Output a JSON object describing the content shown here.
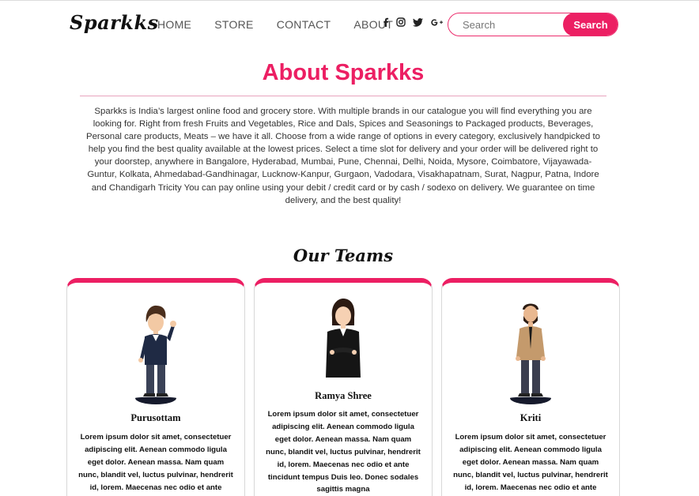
{
  "brand": {
    "logo": "Sparkks"
  },
  "nav": {
    "items": [
      "HOME",
      "STORE",
      "CONTACT",
      "ABOUT"
    ]
  },
  "social": {
    "icons": [
      "facebook-icon",
      "instagram-icon",
      "twitter-icon",
      "google-plus-icon"
    ]
  },
  "search": {
    "placeholder": "Search",
    "button_label": "Search"
  },
  "about": {
    "title": "About Sparkks",
    "text": "Sparkks is India’s largest online food and grocery store. With multiple brands in our catalogue you will find everything you are looking for. Right from fresh Fruits and Vegetables, Rice and Dals, Spices and Seasonings to Packaged products, Beverages, Personal care products, Meats – we have it all. Choose from a wide range of options in every category, exclusively handpicked to help you find the best quality available at the lowest prices. Select a time slot for delivery and your order will be delivered right to your doorstep, anywhere in Bangalore, Hyderabad, Mumbai, Pune, Chennai, Delhi, Noida, Mysore, Coimbatore, Vijayawada-Guntur, Kolkata, Ahmedabad-Gandhinagar, Lucknow-Kanpur, Gurgaon, Vadodara, Visakhapatnam, Surat, Nagpur, Patna, Indore and Chandigarh Tricity You can pay online using your debit / credit card or by cash / sodexo on delivery. We guarantee on time delivery, and the best quality!"
  },
  "teams": {
    "title": "Our Teams",
    "members": [
      {
        "name": "Purusottam",
        "bio": "Lorem ipsum dolor sit amet, consectetuer adipiscing elit. Aenean commodo ligula eget dolor. Aenean massa. Nam quam nunc, blandit vel, luctus pulvinar, hendrerit id, lorem. Maecenas nec odio et ante tincidunt tempus Duis leo. Donec sodales sagittis magna"
      },
      {
        "name": "Ramya Shree",
        "bio": "Lorem ipsum dolor sit amet, consectetuer adipiscing elit. Aenean commodo ligula eget dolor. Aenean massa. Nam quam nunc, blandit vel, luctus pulvinar, hendrerit id, lorem. Maecenas nec odio et ante tincidunt tempus Duis leo. Donec sodales sagittis magna"
      },
      {
        "name": "Kriti",
        "bio": "Lorem ipsum dolor sit amet, consectetuer adipiscing elit. Aenean commodo ligula eget dolor. Aenean massa. Nam quam nunc, blandit vel, luctus pulvinar, hendrerit id, lorem. Maecenas nec odio et ante tincidunt tempus Duis leo. Donec sodales sagittis magna"
      }
    ]
  },
  "colors": {
    "accent": "#ec1f63",
    "text": "#333333"
  }
}
